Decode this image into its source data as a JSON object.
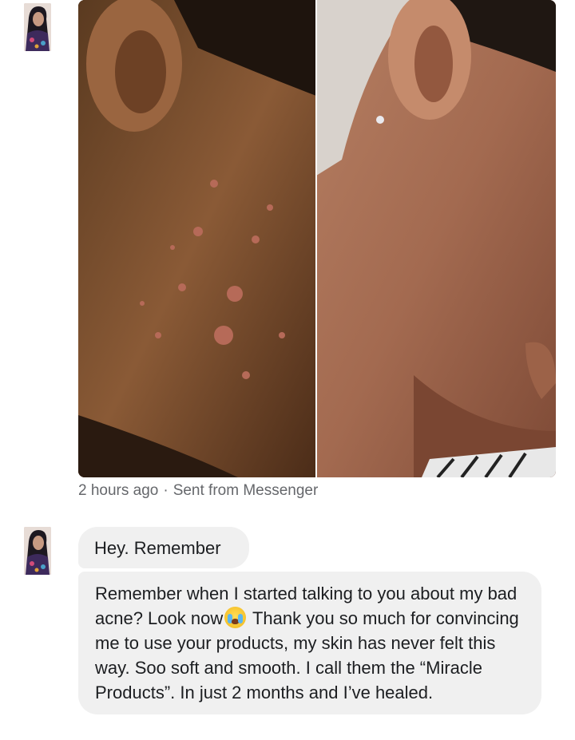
{
  "post": {
    "meta_time": "2 hours ago",
    "meta_separator": "·",
    "meta_source": "Sent from Messenger"
  },
  "messages": [
    {
      "text": "Hey. Remember"
    },
    {
      "text_before_emoji": "Remember when I started talking to you about my bad acne? Look now",
      "emoji": "crying-face-emoji",
      "text_after_emoji": " Thank you so much for convincing me to use your products, my skin has never felt this way. Soo soft and smooth. I call them the “Miracle Products”. In just 2 months and I’ve healed."
    }
  ],
  "colors": {
    "bubble_bg": "#f0f0f0",
    "meta_text": "#65676b"
  }
}
